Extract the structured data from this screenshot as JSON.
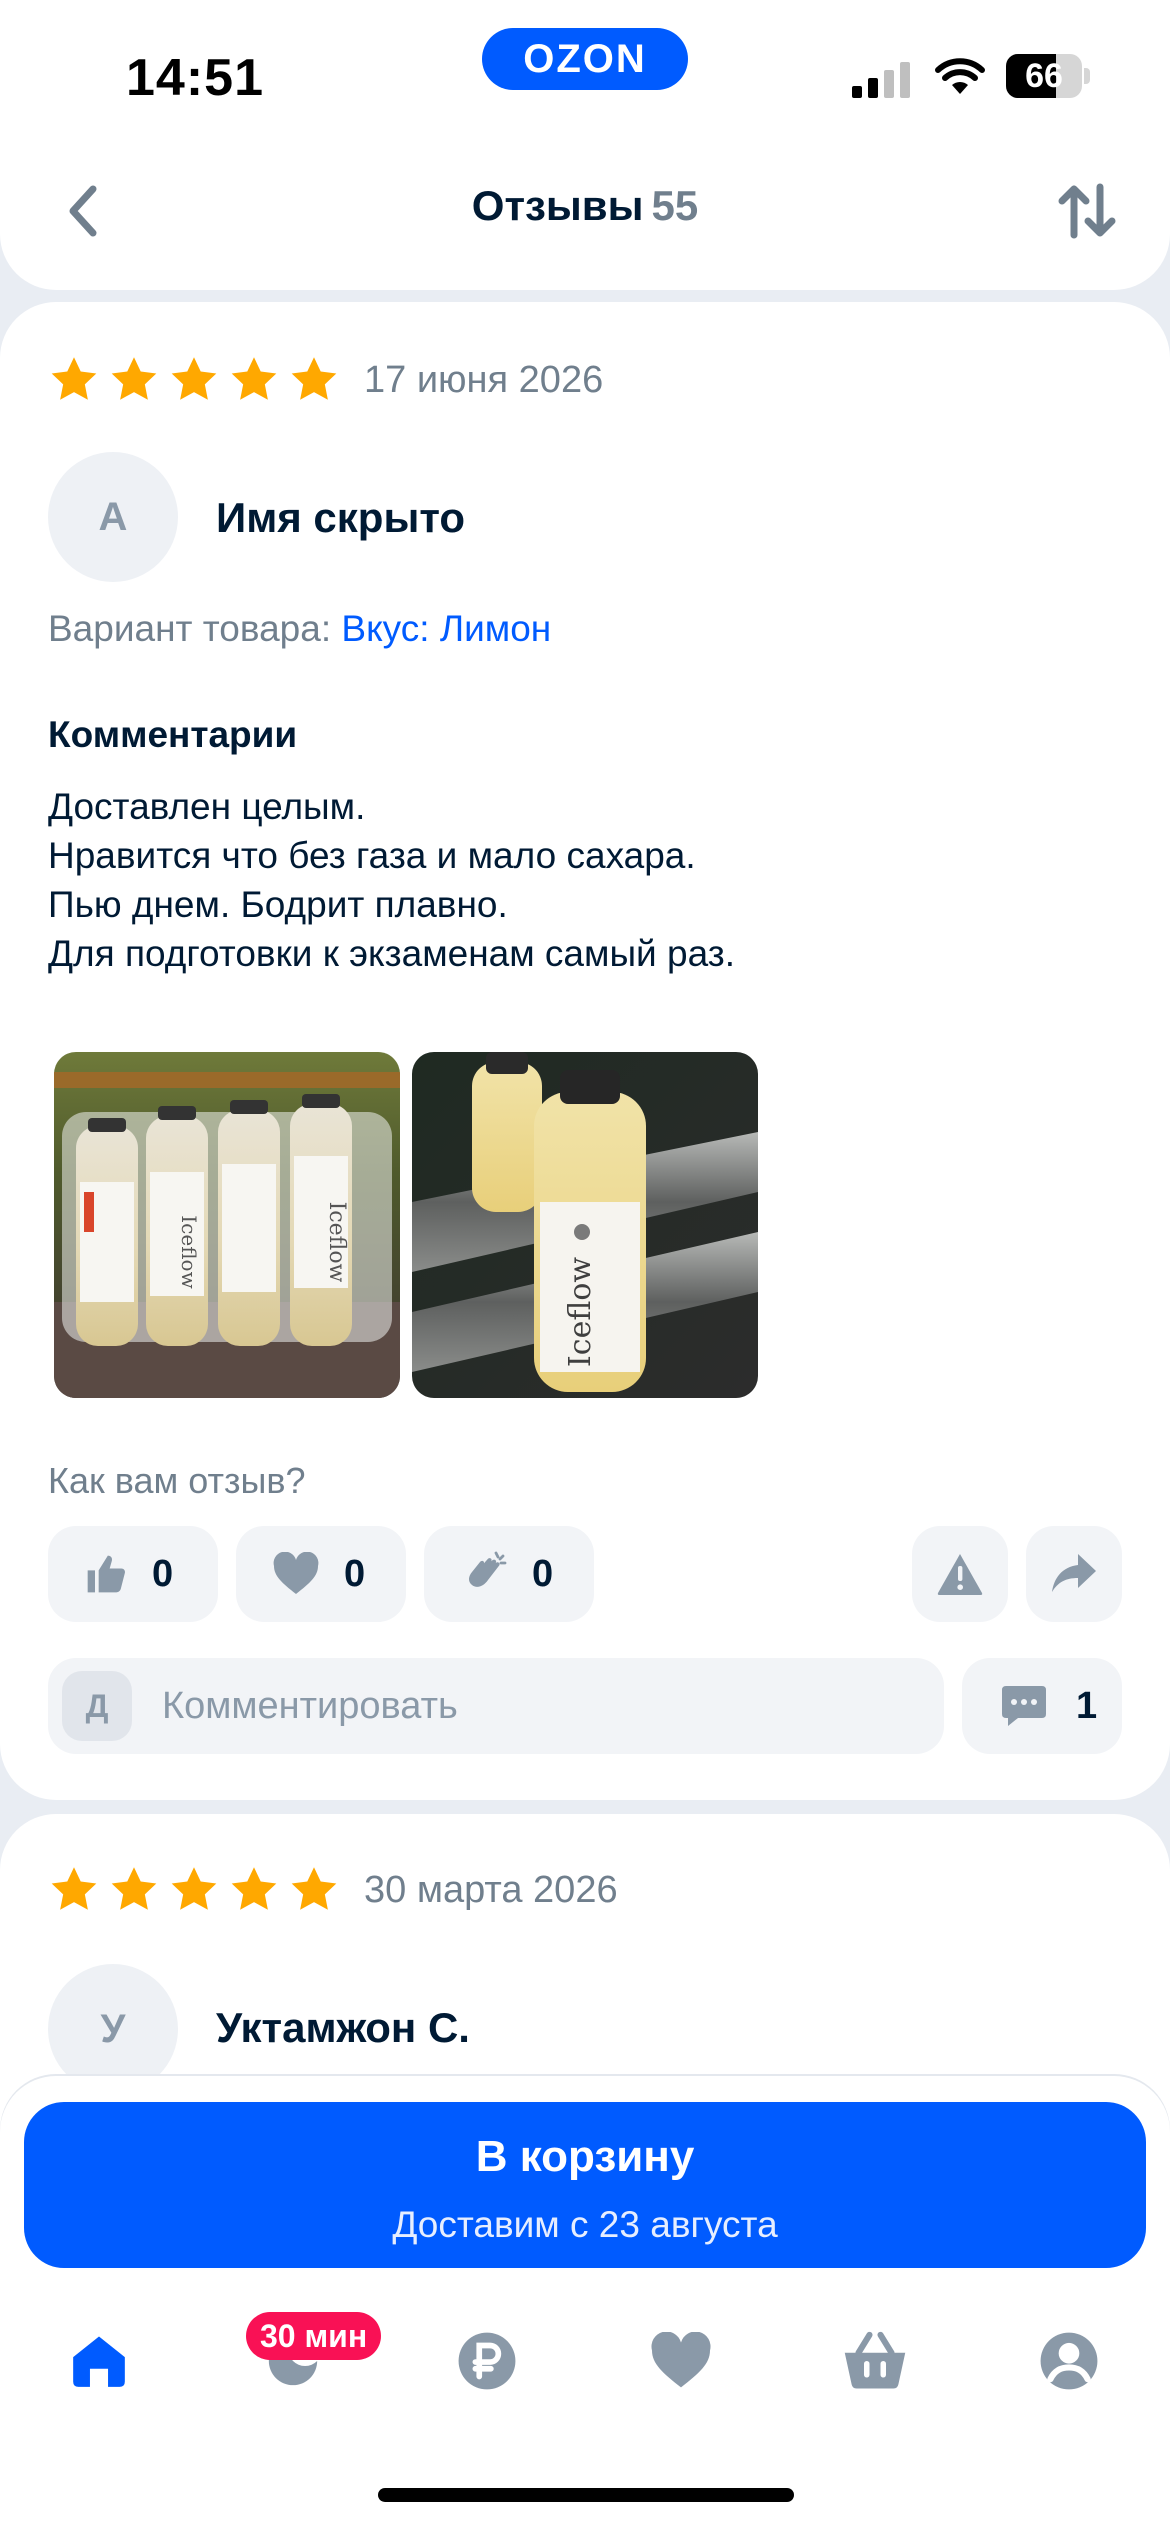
{
  "status_bar": {
    "time": "14:51",
    "brand": "OZON",
    "battery": "66"
  },
  "header": {
    "title": "Отзывы",
    "count": "55",
    "back_icon": "chevron-left-icon",
    "sort_icon": "sort-arrows-icon"
  },
  "reviews": [
    {
      "rating": 5,
      "date": "17 июня 2026",
      "avatar_letter": "А",
      "author": "Имя скрыто",
      "variant_label": "Вариант товара:",
      "variant_value": "Вкус: Лимон",
      "comment_label": "Комментарии",
      "comment_lines": [
        "Доставлен целым.",
        "Нравится что без газа и мало сахара.",
        "Пью днем. Бодрит плавно.",
        "Для подготовки к экзаменам самый раз."
      ],
      "photo_text": [
        "Iceflow",
        "Iceflow"
      ],
      "rate_question": "Как вам отзыв?",
      "reactions": {
        "like": "0",
        "heart": "0",
        "clap": "0"
      },
      "comment_avatar_letter": "Д",
      "comment_placeholder": "Комментировать",
      "comments_count": "1"
    },
    {
      "rating": 5,
      "date": "30 марта 2026",
      "avatar_letter": "У",
      "author": "Уктамжон С."
    }
  ],
  "cart_button": {
    "label": "В корзину",
    "sublabel": "Доставим с 23 августа"
  },
  "tabbar": {
    "badge": "30 мин",
    "items": [
      "home-icon",
      "fresh-icon",
      "ruble-icon",
      "heart-icon",
      "basket-icon",
      "profile-icon"
    ]
  },
  "colors": {
    "brand_blue": "#005bff",
    "star": "#ffa800",
    "badge_pink": "#f91155",
    "muted": "#707f8d"
  }
}
